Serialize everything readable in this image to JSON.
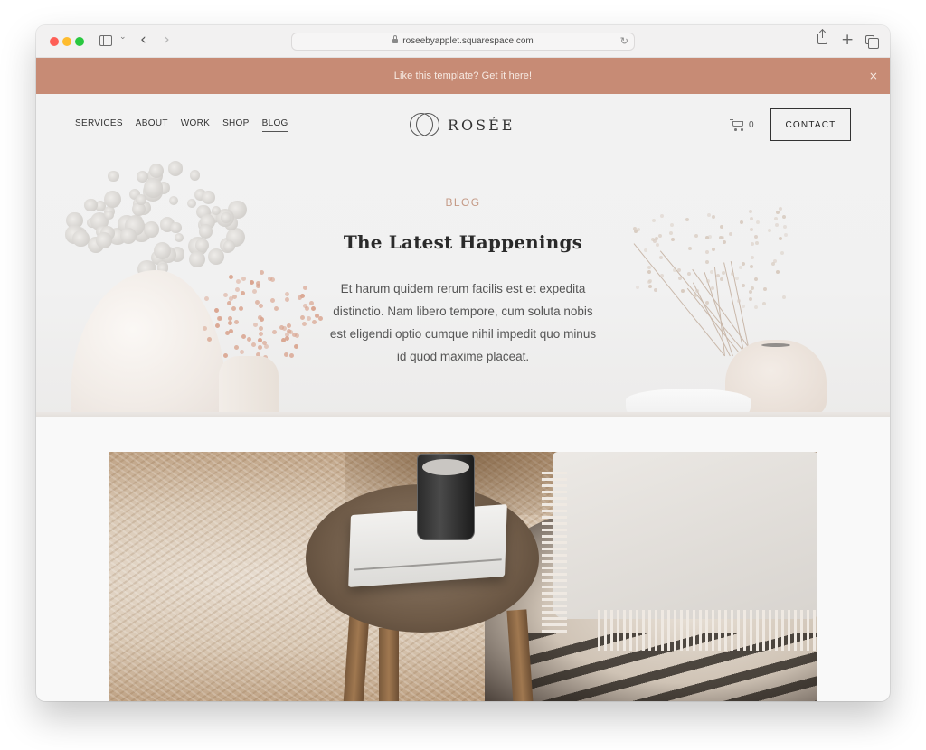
{
  "browser": {
    "url": "roseebyapplet.squarespace.com",
    "icons": {
      "sidebar": "sidebar-icon",
      "chevron": "chevron-down-icon",
      "back": "chevron-left-icon",
      "forward": "chevron-right-icon",
      "lock": "lock-icon",
      "reload": "reload-icon",
      "share": "share-icon",
      "new_tab": "plus-icon",
      "tabs": "tabs-overview-icon"
    },
    "glyphs": {
      "chevron": "⌄",
      "back": "‹",
      "forward": "›",
      "reload": "↻",
      "plus": "+"
    }
  },
  "announcement": {
    "text": "Like this template? Get it here!",
    "close": "×",
    "background": "#c78b75"
  },
  "header": {
    "nav": [
      {
        "label": "SERVICES",
        "active": false
      },
      {
        "label": "ABOUT",
        "active": false
      },
      {
        "label": "WORK",
        "active": false
      },
      {
        "label": "SHOP",
        "active": false
      },
      {
        "label": "BLOG",
        "active": true
      }
    ],
    "logo": "ROSÉE",
    "cart_count": "0",
    "contact_label": "CONTACT"
  },
  "hero": {
    "eyebrow": "BLOG",
    "title": "The Latest Happenings",
    "body": "Et harum quidem rerum facilis est et expedita distinctio. Nam libero tempore, cum soluta nobis est eligendi optio cumque nihil impedit quo minus id quod maxime placeat.",
    "accent_color": "#c59a86"
  },
  "feature": {
    "image_alt": "Wooden stool with notebook and dark glass on shaggy rug beside cushioned pouf"
  }
}
